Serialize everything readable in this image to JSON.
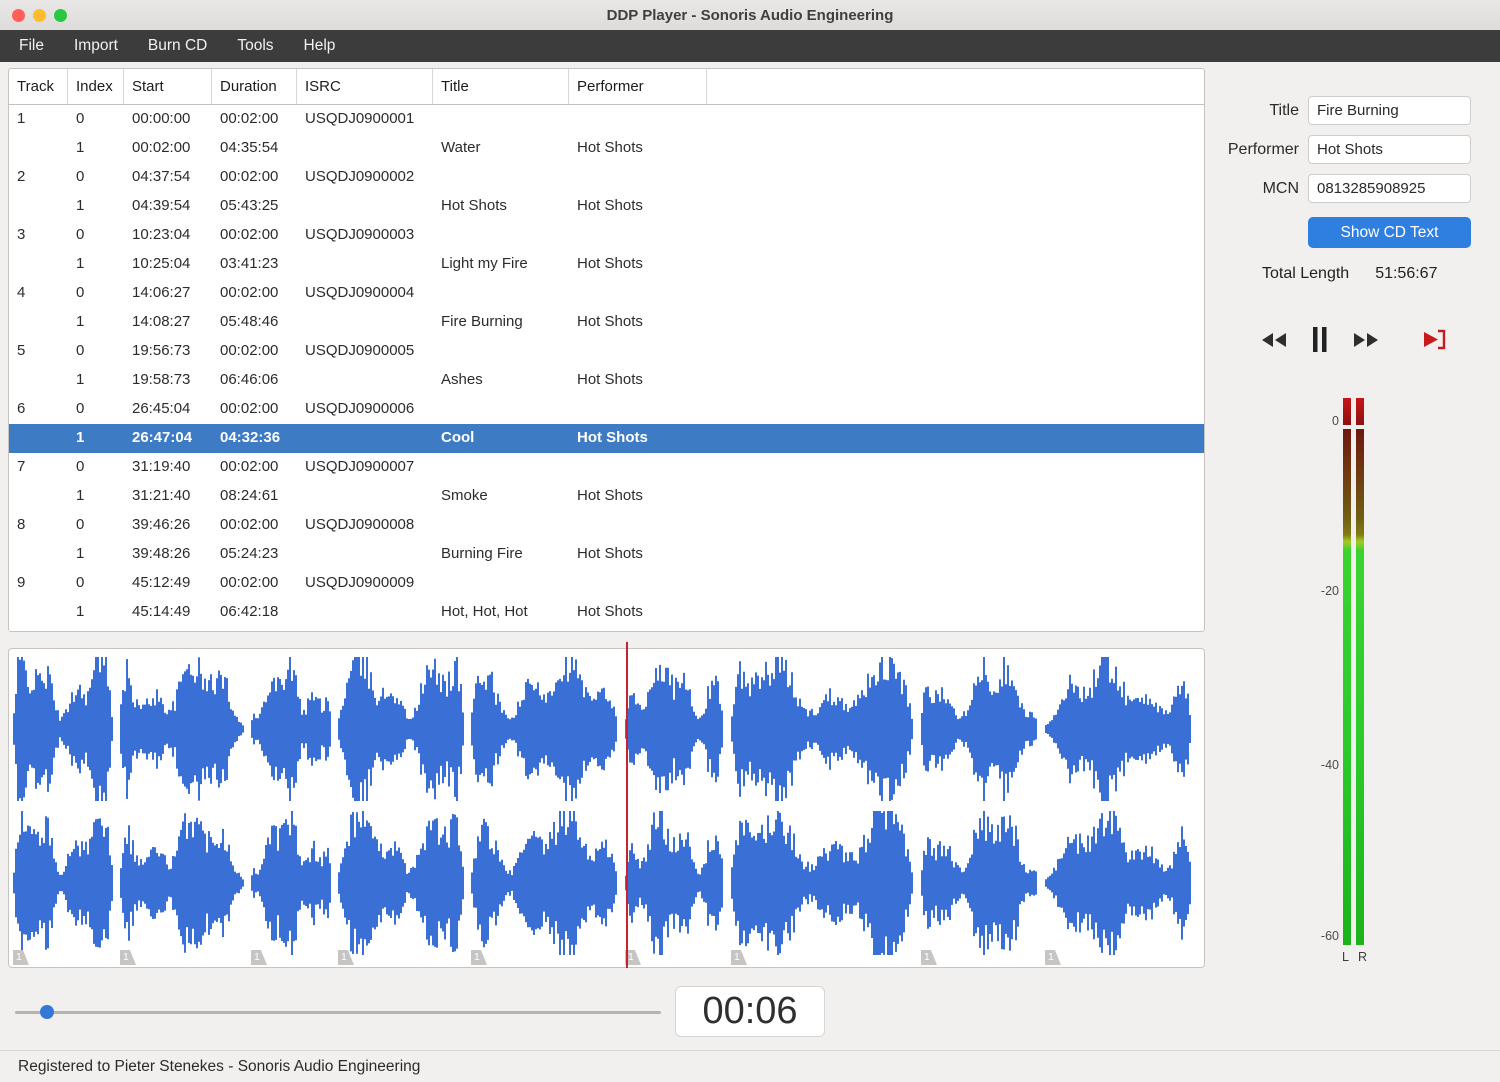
{
  "window": {
    "title": "DDP Player - Sonoris Audio Engineering"
  },
  "menu": {
    "items": [
      "File",
      "Import",
      "Burn CD",
      "Tools",
      "Help"
    ]
  },
  "track_table": {
    "columns": [
      "Track",
      "Index",
      "Start",
      "Duration",
      "ISRC",
      "Title",
      "Performer"
    ],
    "rows": [
      {
        "track": "1",
        "index": "0",
        "start": "00:00:00",
        "duration": "00:02:00",
        "isrc": "USQDJ0900001",
        "title": "",
        "performer": ""
      },
      {
        "track": "",
        "index": "1",
        "start": "00:02:00",
        "duration": "04:35:54",
        "isrc": "",
        "title": "Water",
        "performer": "Hot Shots"
      },
      {
        "track": "2",
        "index": "0",
        "start": "04:37:54",
        "duration": "00:02:00",
        "isrc": "USQDJ0900002",
        "title": "",
        "performer": ""
      },
      {
        "track": "",
        "index": "1",
        "start": "04:39:54",
        "duration": "05:43:25",
        "isrc": "",
        "title": "Hot Shots",
        "performer": "Hot Shots"
      },
      {
        "track": "3",
        "index": "0",
        "start": "10:23:04",
        "duration": "00:02:00",
        "isrc": "USQDJ0900003",
        "title": "",
        "performer": ""
      },
      {
        "track": "",
        "index": "1",
        "start": "10:25:04",
        "duration": "03:41:23",
        "isrc": "",
        "title": "Light my Fire",
        "performer": "Hot Shots"
      },
      {
        "track": "4",
        "index": "0",
        "start": "14:06:27",
        "duration": "00:02:00",
        "isrc": "USQDJ0900004",
        "title": "",
        "performer": ""
      },
      {
        "track": "",
        "index": "1",
        "start": "14:08:27",
        "duration": "05:48:46",
        "isrc": "",
        "title": "Fire Burning",
        "performer": "Hot Shots"
      },
      {
        "track": "5",
        "index": "0",
        "start": "19:56:73",
        "duration": "00:02:00",
        "isrc": "USQDJ0900005",
        "title": "",
        "performer": ""
      },
      {
        "track": "",
        "index": "1",
        "start": "19:58:73",
        "duration": "06:46:06",
        "isrc": "",
        "title": "Ashes",
        "performer": "Hot Shots"
      },
      {
        "track": "6",
        "index": "0",
        "start": "26:45:04",
        "duration": "00:02:00",
        "isrc": "USQDJ0900006",
        "title": "",
        "performer": ""
      },
      {
        "track": "",
        "index": "1",
        "start": "26:47:04",
        "duration": "04:32:36",
        "isrc": "",
        "title": "Cool",
        "performer": "Hot Shots",
        "selected": true
      },
      {
        "track": "7",
        "index": "0",
        "start": "31:19:40",
        "duration": "00:02:00",
        "isrc": "USQDJ0900007",
        "title": "",
        "performer": ""
      },
      {
        "track": "",
        "index": "1",
        "start": "31:21:40",
        "duration": "08:24:61",
        "isrc": "",
        "title": "Smoke",
        "performer": "Hot Shots"
      },
      {
        "track": "8",
        "index": "0",
        "start": "39:46:26",
        "duration": "00:02:00",
        "isrc": "USQDJ0900008",
        "title": "",
        "performer": ""
      },
      {
        "track": "",
        "index": "1",
        "start": "39:48:26",
        "duration": "05:24:23",
        "isrc": "",
        "title": "Burning Fire",
        "performer": "Hot Shots"
      },
      {
        "track": "9",
        "index": "0",
        "start": "45:12:49",
        "duration": "00:02:00",
        "isrc": "USQDJ0900009",
        "title": "",
        "performer": ""
      },
      {
        "track": "",
        "index": "1",
        "start": "45:14:49",
        "duration": "06:42:18",
        "isrc": "",
        "title": "Hot, Hot, Hot",
        "performer": "Hot Shots"
      }
    ]
  },
  "cd_text": {
    "title_label": "Title",
    "title_value": "Fire Burning",
    "performer_label": "Performer",
    "performer_value": "Hot Shots",
    "mcn_label": "MCN",
    "mcn_value": "0813285908925",
    "show_cd_text_button": "Show CD Text",
    "total_length_label": "Total Length",
    "total_length_value": "51:56:67"
  },
  "meter": {
    "scale_labels": [
      "0",
      "-20",
      "-40",
      "-60"
    ],
    "channel_labels": [
      "L",
      "R"
    ]
  },
  "waveform": {
    "marker_label": "1",
    "playhead_fraction": 0.518,
    "track_durations_sec": [
      276,
      343,
      221,
      349,
      406,
      273,
      505,
      324,
      402
    ]
  },
  "footer": {
    "time_display": "00:06",
    "slider_fraction": 0.04,
    "status_text": "Registered to Pieter Stenekes - Sonoris Audio Engineering"
  },
  "colors": {
    "accent_blue": "#2f7fe0",
    "selection_blue": "#3d7cc4",
    "waveform_blue": "#3a6fd6",
    "playhead_red": "#c22530",
    "meter_green": "#2bc92b",
    "meter_red": "#c81717"
  }
}
